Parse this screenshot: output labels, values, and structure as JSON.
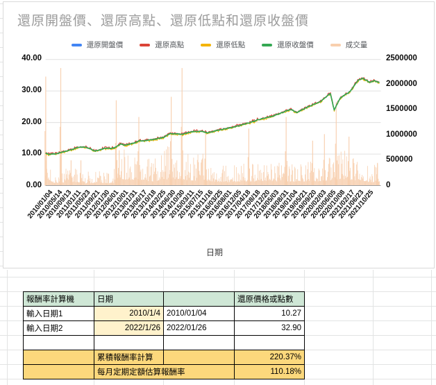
{
  "chart": {
    "title": "還原開盤價、還原高點、還原低點和還原收盤價",
    "x_axis_title": "日期",
    "legend": [
      {
        "label": "還原開盤價",
        "color": "#4285f4"
      },
      {
        "label": "還原高點",
        "color": "#db4437"
      },
      {
        "label": "還原低點",
        "color": "#f4b400"
      },
      {
        "label": "還原收盤價",
        "color": "#34a853"
      },
      {
        "label": "成交量",
        "color": "#f8cfae"
      }
    ],
    "left_axis_ticks": [
      "40.00",
      "30.00",
      "20.00",
      "10.00",
      "0.00"
    ],
    "right_axis_ticks": [
      "2500000",
      "2000000",
      "1500000",
      "1000000",
      "500000",
      "0"
    ]
  },
  "chart_data": {
    "type": "line+bar combo",
    "x_label": "日期",
    "left_axis_range": [
      0,
      40
    ],
    "right_axis_range": [
      0,
      2500000
    ],
    "grid": "horizontal only",
    "legend_position": "top center",
    "categories": [
      "2010/01/04",
      "2010/05/14",
      "2010/09/13",
      "2011/01/11",
      "2011/05/23",
      "2011/09/21",
      "2012/01/30",
      "2012/06/01",
      "2012/10/01",
      "2013/01/31",
      "2013/06/17",
      "2013/10/18",
      "2014/02/25",
      "2014/06/30",
      "2014/10/30",
      "2015/03/11",
      "2015/07/15",
      "2015/11/16",
      "2016/03/25",
      "2016/08/01",
      "2016/12/05",
      "2017/04/18",
      "2017/08/18",
      "2017/12/20",
      "2018/05/03",
      "2018/08/31",
      "2019/01/04",
      "2019/05/21",
      "2019/09/20",
      "2020/02/03",
      "2020/06/05",
      "2020/10/08",
      "2021/02/17",
      "2021/06/23",
      "2021/10/25"
    ],
    "series": [
      {
        "name": "還原開盤價",
        "axis": "left",
        "type": "line",
        "color": "#4285f4",
        "values": [
          10.2,
          9.9,
          10.8,
          11.9,
          12.1,
          10.9,
          11.7,
          12.0,
          12.9,
          13.5,
          14.2,
          14.7,
          15.2,
          16.2,
          16.3,
          17.1,
          17.2,
          17.2,
          17.9,
          18.5,
          19.2,
          20.2,
          21.1,
          21.9,
          23.1,
          24.2,
          23.9,
          25.4,
          26.7,
          29.2,
          27.7,
          29.7,
          33.7,
          32.8,
          32.8
        ]
      },
      {
        "name": "還原高點",
        "axis": "left",
        "type": "line",
        "color": "#db4437",
        "values": [
          10.6,
          10.3,
          11.2,
          12.3,
          12.5,
          11.3,
          12.1,
          12.4,
          13.3,
          13.9,
          14.6,
          15.1,
          15.6,
          16.6,
          16.7,
          17.5,
          17.6,
          17.6,
          18.3,
          18.9,
          19.6,
          20.6,
          21.5,
          22.3,
          23.5,
          24.6,
          24.3,
          25.8,
          27.1,
          29.6,
          28.1,
          30.1,
          34.1,
          33.2,
          33.2
        ]
      },
      {
        "name": "還原低點",
        "axis": "left",
        "type": "line",
        "color": "#f4b400",
        "values": [
          10.0,
          9.7,
          10.6,
          11.7,
          11.9,
          10.7,
          11.5,
          11.8,
          12.7,
          13.3,
          14.0,
          14.5,
          15.0,
          16.0,
          16.1,
          16.9,
          17.0,
          17.0,
          17.7,
          18.3,
          19.0,
          20.0,
          20.9,
          21.7,
          22.9,
          24.0,
          23.7,
          25.2,
          26.5,
          29.0,
          27.5,
          29.5,
          33.5,
          32.6,
          32.6
        ]
      },
      {
        "name": "還原收盤價",
        "axis": "left",
        "type": "line",
        "color": "#34a853",
        "values": [
          10.3,
          10.0,
          10.9,
          12.0,
          12.2,
          11.0,
          11.8,
          12.1,
          13.0,
          13.6,
          14.3,
          14.8,
          15.3,
          16.3,
          16.4,
          17.2,
          17.3,
          17.3,
          18.0,
          18.6,
          19.3,
          20.3,
          21.2,
          22.0,
          23.2,
          24.3,
          24.0,
          25.5,
          26.8,
          29.3,
          27.8,
          29.8,
          33.8,
          32.9,
          32.9
        ]
      },
      {
        "name": "成交量",
        "axis": "right",
        "type": "bar",
        "color": "#f8cfae",
        "values": [
          500000,
          150000,
          200000,
          250000,
          150000,
          200000,
          150000,
          200000,
          450000,
          400000,
          400000,
          300000,
          450000,
          500000,
          400000,
          350000,
          400000,
          300000,
          250000,
          250000,
          300000,
          300000,
          300000,
          300000,
          350000,
          300000,
          300000,
          300000,
          300000,
          350000,
          500000,
          400000,
          400000,
          200000,
          300000
        ]
      }
    ],
    "close_extra_points": [
      [
        0.4,
        9.8
      ],
      [
        3.5,
        12.3
      ],
      [
        4.6,
        11.6
      ],
      [
        7.7,
        13.4
      ],
      [
        9.6,
        14.4
      ],
      [
        12.7,
        16.5
      ],
      [
        16.5,
        16.9
      ],
      [
        25.6,
        23.4
      ],
      [
        29.4,
        24.0
      ],
      [
        29.8,
        26.5
      ],
      [
        31.8,
        33.5
      ],
      [
        32.3,
        34.2
      ],
      [
        33.5,
        33.3
      ]
    ],
    "volume_spikes": [
      [
        0.02,
        2160000
      ],
      [
        1.55,
        2330000
      ],
      [
        2.6,
        500000
      ],
      [
        3.6,
        500000
      ],
      [
        7.2,
        1690000
      ],
      [
        7.5,
        700000
      ],
      [
        9.5,
        1360000
      ],
      [
        12.8,
        1760000
      ],
      [
        13.9,
        2330000
      ],
      [
        16.3,
        1070000
      ],
      [
        20.7,
        1130000
      ],
      [
        24.5,
        1360000
      ],
      [
        27.2,
        890000
      ],
      [
        28.4,
        1020000
      ],
      [
        29.6,
        1660000
      ],
      [
        30.9,
        970000
      ],
      [
        33.8,
        450000
      ]
    ]
  },
  "table": {
    "rows": [
      {
        "cells": [
          {
            "t": "報酬率計算機",
            "bg": "green",
            "al": "l"
          },
          {
            "t": "日期",
            "bg": "green",
            "al": "l"
          },
          {
            "t": "",
            "bg": "green"
          },
          {
            "t": "還原價格或點數",
            "bg": "green",
            "al": "l"
          }
        ]
      },
      {
        "cells": [
          {
            "t": "輸入日期1",
            "al": "l"
          },
          {
            "t": "2010/1/4",
            "bg": "yellow",
            "al": "r"
          },
          {
            "t": "2010/01/04",
            "al": "l"
          },
          {
            "t": "10.27",
            "al": "r"
          }
        ]
      },
      {
        "cells": [
          {
            "t": "輸入日期2",
            "al": "l"
          },
          {
            "t": "2022/1/26",
            "bg": "yellow",
            "al": "r"
          },
          {
            "t": "2022/01/26",
            "al": "l"
          },
          {
            "t": "32.90",
            "al": "r"
          }
        ]
      },
      {
        "cells": [
          {
            "t": ""
          },
          {
            "t": ""
          },
          {
            "t": ""
          },
          {
            "t": ""
          }
        ]
      },
      {
        "cells": [
          {
            "t": "",
            "bg": "orange"
          },
          {
            "t": "累積報酬率計算",
            "bg": "orange",
            "al": "l"
          },
          {
            "t": "",
            "bg": "orange"
          },
          {
            "t": "220.37%",
            "bg": "orange",
            "al": "r"
          }
        ]
      },
      {
        "cells": [
          {
            "t": "",
            "bg": "orange"
          },
          {
            "t": "每月定期定額估算報酬率",
            "bg": "orange",
            "al": "l",
            "colspan": 2
          },
          {
            "t": "110.18%",
            "bg": "orange",
            "al": "r"
          }
        ]
      }
    ]
  },
  "colors": {
    "header_green": "#cfe7d6",
    "input_yellow": "#fff2cc",
    "result_orange": "#fcd87c",
    "gridline": "#e0e0e0",
    "axis_line": "#9e9e9e",
    "volume_fill": "#f8cfae",
    "card_border": "#d9d9d9",
    "title_gray": "#9b9b9b"
  }
}
